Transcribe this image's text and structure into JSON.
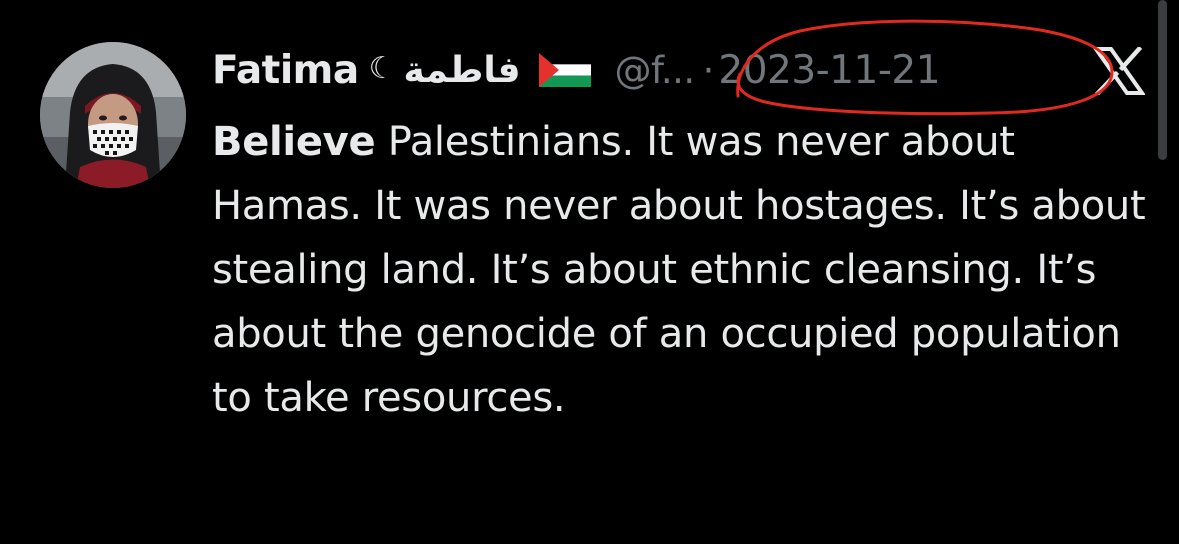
{
  "tweet": {
    "author": {
      "display_name": "Fatima",
      "moon_glyph": "☾",
      "name_arabic": "فاطمة",
      "flag_icon": "palestine-flag-icon",
      "handle": "@f...",
      "avatar_icon": "profile-photo"
    },
    "separator": "·",
    "date": "2023-11-21",
    "platform_icon": "x-logo-icon",
    "text": {
      "bold_lead": "Believe",
      "rest": " Palestinians. It was never about Hamas. It was never about hostages. It’s about stealing land. It’s about ethnic cleansing. It’s about the genocide of an occupied population to take resources."
    }
  },
  "annotation": {
    "type": "hand-drawn-circle",
    "color": "#e0291f",
    "target": "date"
  },
  "colors": {
    "background": "#000000",
    "primary_text": "#e7e9ea",
    "secondary_text": "#71767b",
    "flag_black": "#000000",
    "flag_white": "#ffffff",
    "flag_green": "#149954",
    "flag_red": "#e4312b"
  }
}
